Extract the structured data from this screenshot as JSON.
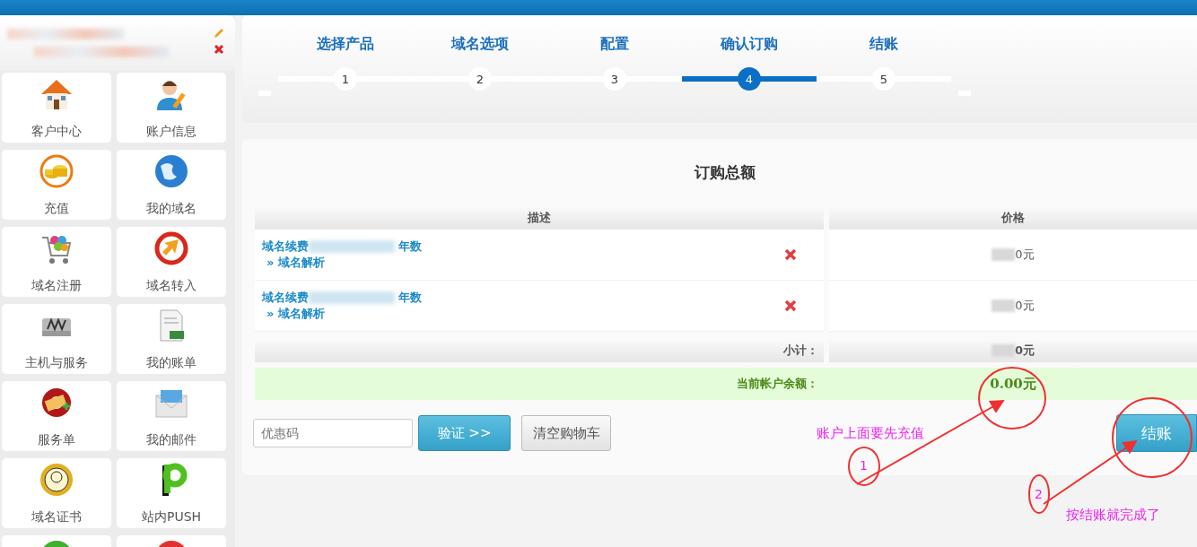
{
  "sidebar": {
    "items": [
      {
        "kind": "house",
        "label": "客户中心"
      },
      {
        "kind": "person",
        "label": "账户信息"
      },
      {
        "kind": "coins",
        "label": "充值"
      },
      {
        "kind": "globe",
        "label": "我的域名"
      },
      {
        "kind": "cart",
        "label": "域名注册"
      },
      {
        "kind": "arrow",
        "label": "域名转入"
      },
      {
        "kind": "drive",
        "label": "主机与服务"
      },
      {
        "kind": "bill",
        "label": "我的账单"
      },
      {
        "kind": "lifebuoy",
        "label": "服务单"
      },
      {
        "kind": "envelope",
        "label": "我的邮件"
      },
      {
        "kind": "seal",
        "label": "域名证书"
      },
      {
        "kind": "letter",
        "label": "站内PUSH"
      },
      {
        "kind": "round-green"
      },
      {
        "kind": "round-red"
      }
    ]
  },
  "steps": [
    {
      "label": "选择产品",
      "number": "1",
      "selected": false
    },
    {
      "label": "域名选项",
      "number": "2",
      "selected": false
    },
    {
      "label": "配置",
      "number": "3",
      "selected": false
    },
    {
      "label": "确认订购",
      "number": "4",
      "selected": true
    },
    {
      "label": "结账",
      "number": "5",
      "selected": false
    }
  ],
  "order": {
    "title": "订购总额",
    "columns": [
      "描述",
      "价格"
    ],
    "rows": [
      {
        "description": "域名续费",
        "suffix": "年数",
        "link": "» 域名解析",
        "price": "0元"
      },
      {
        "description": "域名续费",
        "suffix": "年数",
        "link": "» 域名解析",
        "price": "0元"
      }
    ],
    "subtotal": {
      "label": "小计：",
      "value": "0元"
    },
    "balance": {
      "label": "当前帐户余额：",
      "value": "0.00元"
    },
    "coupon": {
      "placeholder": "优惠码"
    },
    "verify_button": "验证 >>",
    "clear_button": "清空购物车",
    "checkout_button": "结账"
  },
  "annotations": [
    {
      "number": "1",
      "text": "账户上面要先充值"
    },
    {
      "number": "2",
      "text": "按结账就完成了"
    }
  ]
}
